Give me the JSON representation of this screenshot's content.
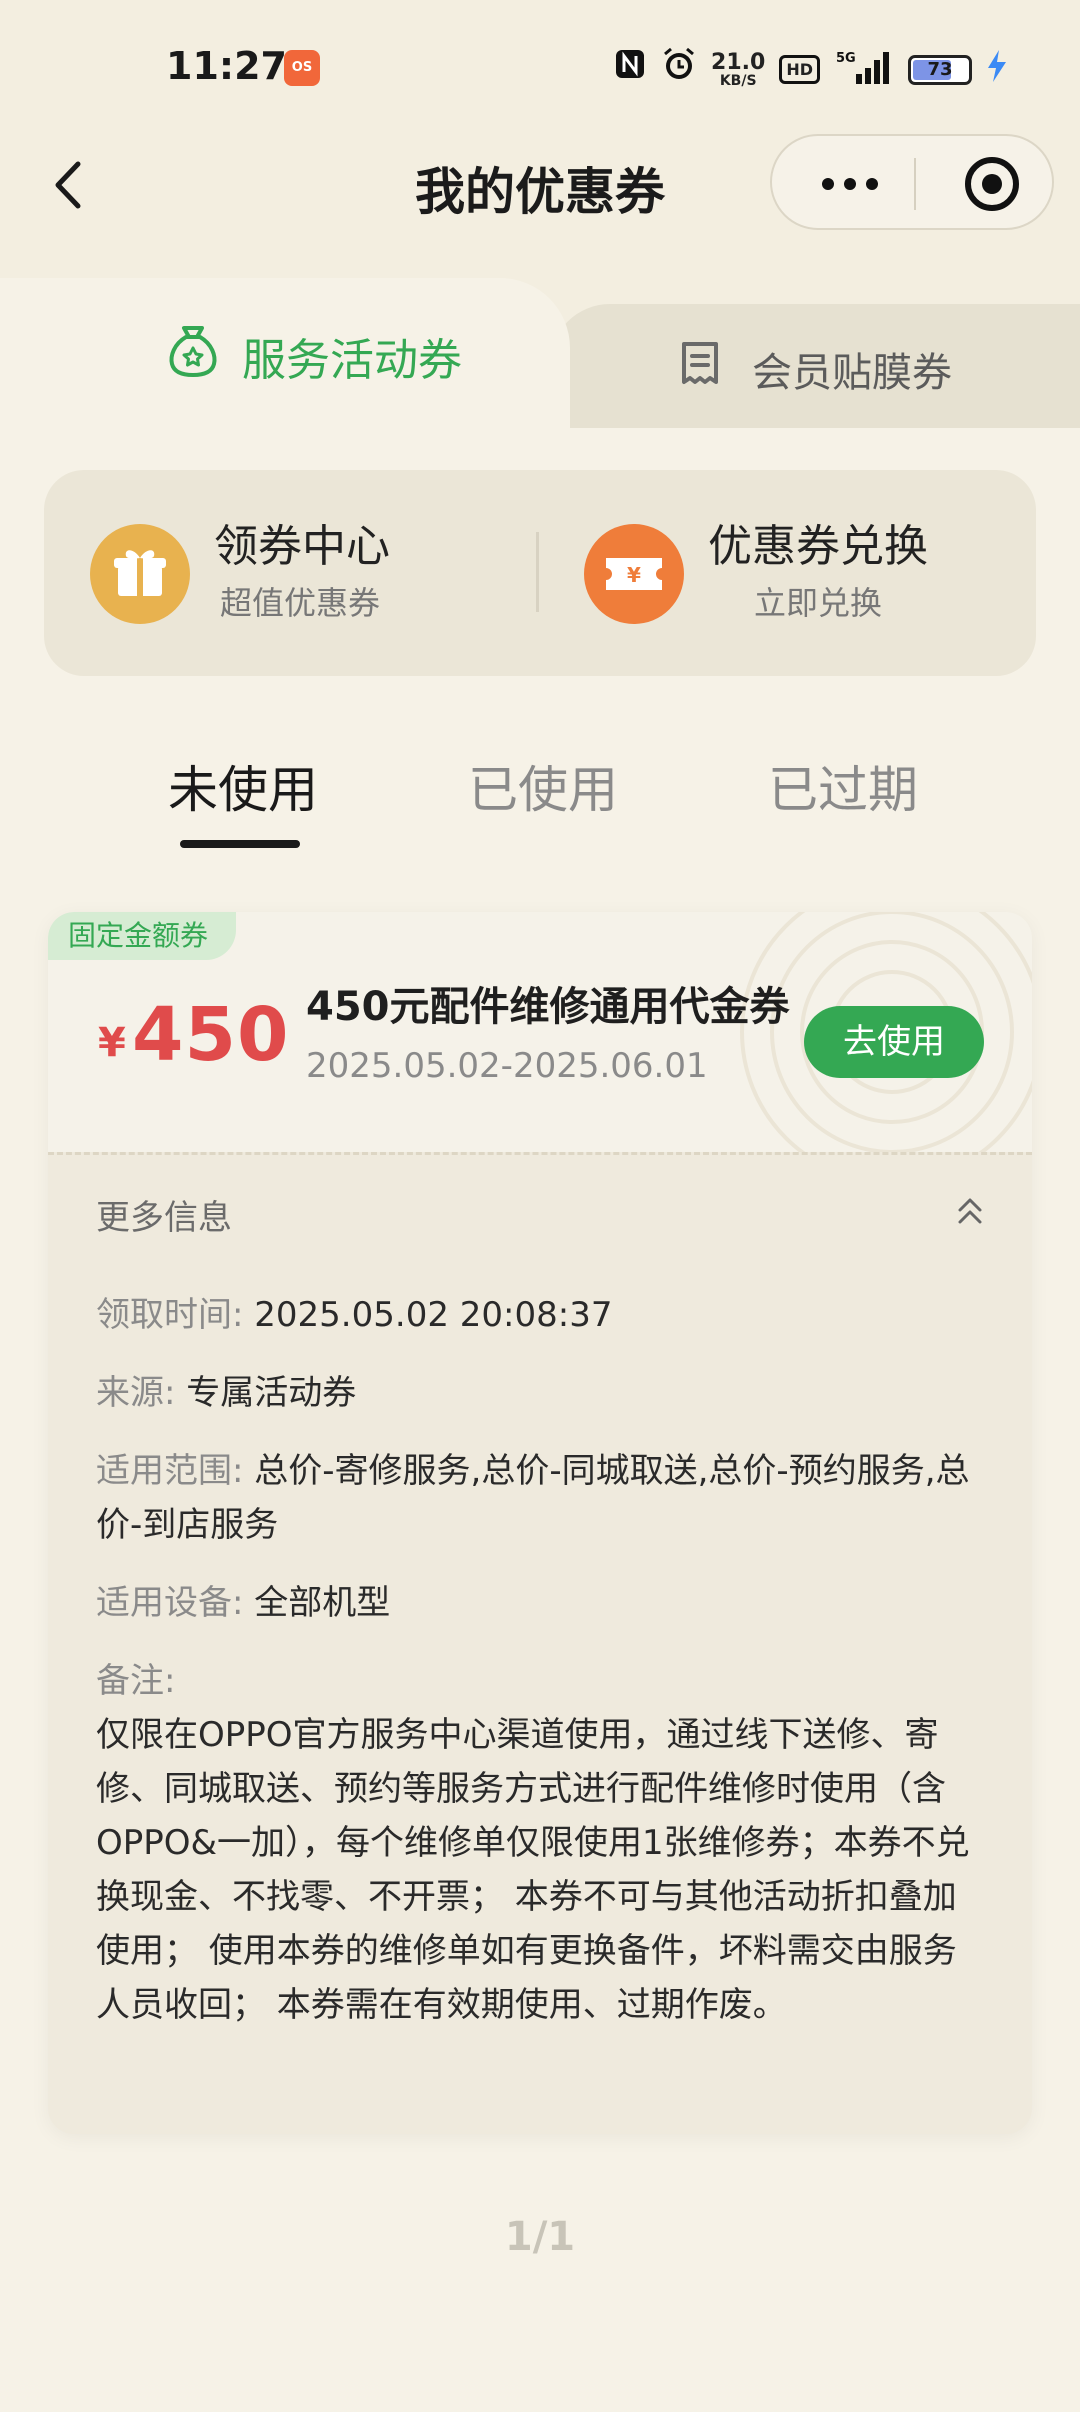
{
  "status_bar": {
    "time": "11:27",
    "app_icon_label": "OS",
    "nfc_icon": "nfc-icon",
    "alarm_icon": "alarm-icon",
    "speed_value": "21.0",
    "speed_unit": "KB/S",
    "hd_badge": "HD",
    "signal_label": "5G",
    "battery_level": "73",
    "battery_fraction": 0.73
  },
  "nav": {
    "title": "我的优惠券",
    "back_icon": "chevron-left-icon",
    "more_icon": "more-dots-icon",
    "close_icon": "target-circle-icon"
  },
  "coupon_types": {
    "active_label": "服务活动券",
    "active_icon": "money-bag-star-icon",
    "inactive_label": "会员贴膜券",
    "inactive_icon": "receipt-icon"
  },
  "quick_actions": [
    {
      "title": "领券中心",
      "subtitle": "超值优惠券",
      "icon": "gift-icon",
      "color": "#e8b24f"
    },
    {
      "title": "优惠券兑换",
      "subtitle": "立即兑换",
      "icon": "yuan-ticket-icon",
      "color": "#ef7d3a"
    }
  ],
  "status_tabs": [
    {
      "label": "未使用",
      "active": true
    },
    {
      "label": "已使用",
      "active": false
    },
    {
      "label": "已过期",
      "active": false
    }
  ],
  "coupon": {
    "tag": "固定金额券",
    "currency": "¥",
    "amount": "450",
    "title": "450元配件维修通用代金券",
    "validity": "2025.05.02-2025.06.01",
    "use_button": "去使用",
    "more_info_label": "更多信息",
    "details": {
      "received_key": "领取时间:",
      "received_val": "2025.05.02 20:08:37",
      "source_key": "来源:",
      "source_val": "专属活动券",
      "scope_key": "适用范围:",
      "scope_val": "总价-寄修服务,总价-同城取送,总价-预约服务,总价-到店服务",
      "devices_key": "适用设备:",
      "devices_val": "全部机型",
      "note_key": "备注:",
      "note_val": "仅限在OPPO官方服务中心渠道使用，通过线下送修、寄修、同城取送、预约等服务方式进行配件维修时使用（含OPPO&一加），每个维修单仅限使用1张维修券；本券不兑换现金、不找零、不开票； 本券不可与其他活动折扣叠加使用； 使用本券的维修单如有更换备件，坏料需交由服务人员收回； 本券需在有效期使用、过期作废。"
    }
  },
  "pager": "1/1",
  "colors": {
    "background": "#f3eee0",
    "accent_green": "#34a853",
    "amount_red": "#e04b4b"
  }
}
